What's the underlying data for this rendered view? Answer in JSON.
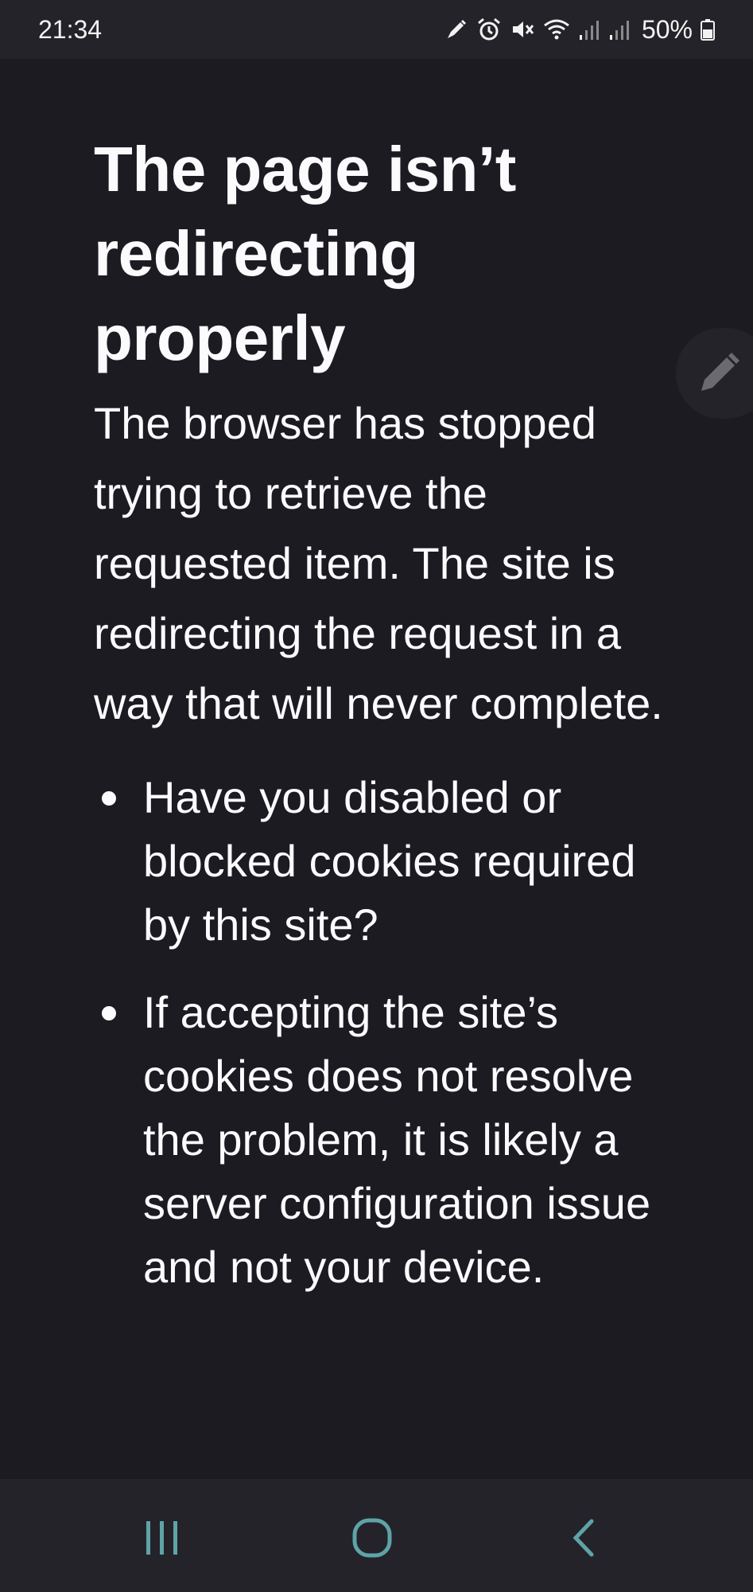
{
  "status_bar": {
    "time": "21:34",
    "battery_percent": "50%",
    "icons": [
      "edit-pen-icon",
      "alarm-icon",
      "mute-icon",
      "wifi-icon",
      "signal-icon",
      "signal-icon",
      "battery-icon"
    ]
  },
  "error_page": {
    "title": "The page isn’t redirecting properly",
    "description": "The browser has stopped trying to retrieve the requested item. The site is redirecting the request in a way that will never complete.",
    "bullets": [
      "Have you disabled or blocked cookies required by this site?",
      "If accepting the site’s cookies does not resolve the problem, it is likely a server configuration issue and not your device."
    ]
  },
  "floating_button": {
    "icon": "pencil-icon"
  },
  "nav_bar": {
    "buttons": [
      "recents-icon",
      "home-icon",
      "back-icon"
    ]
  },
  "colors": {
    "background": "#1c1b22",
    "text": "#fbfbfe",
    "bars": "#242329",
    "nav_icon": "#5ea3a8"
  }
}
